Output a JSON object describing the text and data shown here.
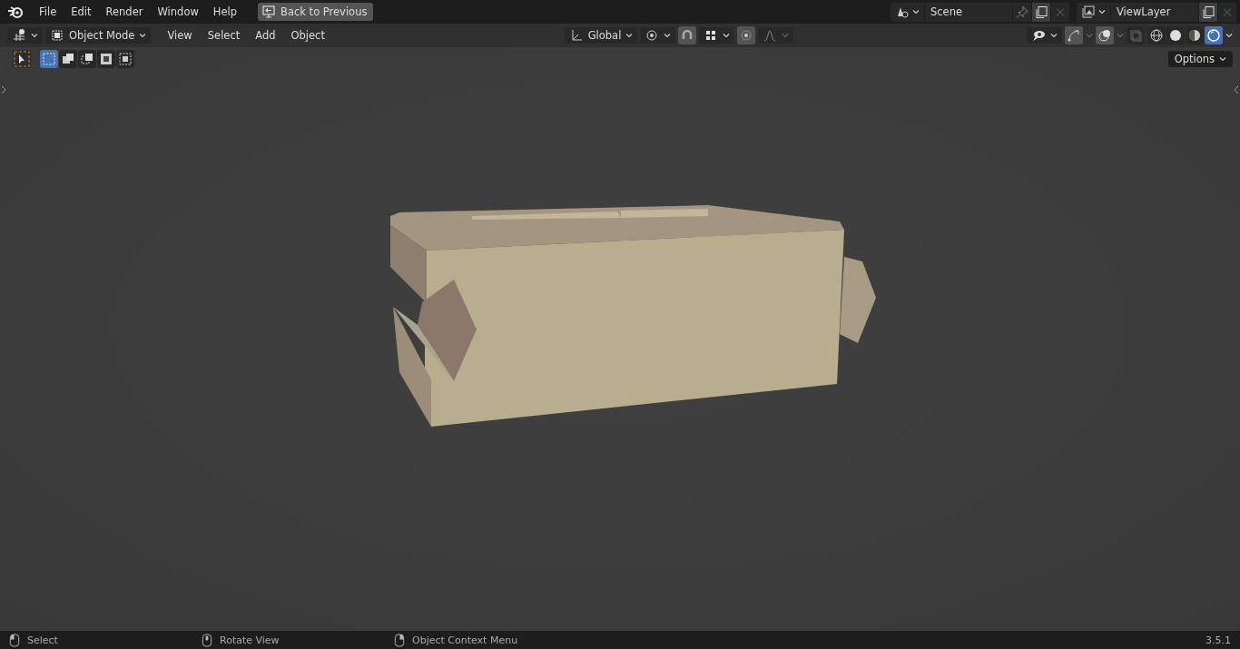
{
  "top_bar": {
    "menus": [
      "File",
      "Edit",
      "Render",
      "Window",
      "Help"
    ],
    "back_button": "Back to Previous",
    "scene": "Scene",
    "view_layer": "ViewLayer"
  },
  "header": {
    "mode": "Object Mode",
    "menus": [
      "View",
      "Select",
      "Add",
      "Object"
    ],
    "orientation": "Global"
  },
  "select_modes": [
    {
      "selected": true
    },
    {
      "selected": false
    },
    {
      "selected": false
    },
    {
      "selected": false
    },
    {
      "selected": false
    }
  ],
  "shading_modes": [
    {
      "kind": "wireframe",
      "selected": false
    },
    {
      "kind": "solid",
      "selected": false
    },
    {
      "kind": "material",
      "selected": false
    },
    {
      "kind": "rendered",
      "selected": true
    }
  ],
  "options": "Options",
  "status_bar": {
    "items": [
      {
        "label": "Select",
        "kind": "left"
      },
      {
        "label": "Rotate View",
        "kind": "middle"
      },
      {
        "label": "Object Context Menu",
        "kind": "right"
      }
    ],
    "version": "3.5.1"
  }
}
